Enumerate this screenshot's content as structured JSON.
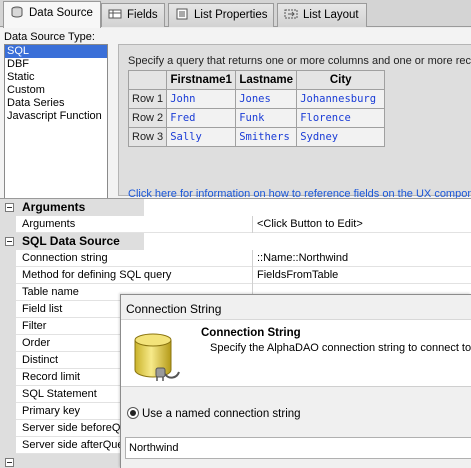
{
  "tabs": [
    {
      "label": "Data Source",
      "icon": "data-source-icon",
      "active": true
    },
    {
      "label": "Fields",
      "icon": "fields-icon",
      "active": false
    },
    {
      "label": "List Properties",
      "icon": "list-properties-icon",
      "active": false
    },
    {
      "label": "List Layout",
      "icon": "list-layout-icon",
      "active": false
    }
  ],
  "data_source": {
    "label": "Data Source Type:",
    "items": [
      "SQL",
      "DBF",
      "Static",
      "Custom",
      "Data Series",
      "Javascript Function"
    ],
    "selected": "SQL"
  },
  "preview": {
    "hint": "Specify a query that returns one or more columns and one or more reco",
    "columns": [
      "Firstname1",
      "Lastname",
      "City"
    ],
    "rows": [
      {
        "label": "Row 1",
        "cells": [
          "John",
          "Jones",
          "Johannesburg"
        ]
      },
      {
        "label": "Row 2",
        "cells": [
          "Fred",
          "Funk",
          "Florence"
        ]
      },
      {
        "label": "Row 3",
        "cells": [
          "Sally",
          "Smithers",
          "Sydney"
        ]
      }
    ],
    "link": "Click here for information on how to reference fields on the UX compone"
  },
  "grid": {
    "arguments_category": "Arguments",
    "arguments_row": {
      "name": "Arguments",
      "value": "<Click Button to Edit>"
    },
    "sql_category": "SQL Data Source",
    "rows": [
      {
        "name": "Connection string",
        "value": "::Name::Northwind"
      },
      {
        "name": "Method for defining SQL query",
        "value": "FieldsFromTable"
      },
      {
        "name": "Table name",
        "value": ""
      },
      {
        "name": "Field list",
        "value": ""
      },
      {
        "name": "Filter",
        "value": ""
      },
      {
        "name": "Order",
        "value": ""
      },
      {
        "name": "Distinct",
        "value": ""
      },
      {
        "name": "Record limit",
        "value": ""
      },
      {
        "name": "SQL Statement",
        "value": ""
      },
      {
        "name": "Primary key",
        "value": ""
      },
      {
        "name": "Server side beforeQu",
        "value": ""
      },
      {
        "name": "Server side afterQuer",
        "value": ""
      }
    ]
  },
  "dialog": {
    "title": "Connection String",
    "heading": "Connection String",
    "subtitle": "Specify the AlphaDAO connection string to connect to",
    "radio_label": "Use a named connection string",
    "connection_value": "Northwind"
  },
  "colors": {
    "selection": "#3a6fd8",
    "link": "#1a57d9",
    "cell_text": "#1a3cd6"
  }
}
